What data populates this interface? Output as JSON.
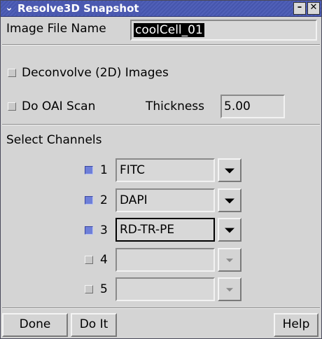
{
  "window": {
    "title": "Resolve3D Snapshot",
    "menu_icon": "chevron-down-icon",
    "minimize_glyph": "–",
    "close_glyph": "✕"
  },
  "image_file": {
    "label": "Image File Name",
    "value": "coolCell_01"
  },
  "options": {
    "deconvolve": {
      "label": "Deconvolve (2D) Images",
      "checked": false
    },
    "oai_scan": {
      "label": "Do OAI Scan",
      "checked": false
    },
    "thickness": {
      "label": "Thickness",
      "value": "5.00"
    }
  },
  "channels": {
    "heading": "Select Channels",
    "items": [
      {
        "number": "1",
        "checked": true,
        "value": "FITC",
        "enabled": true
      },
      {
        "number": "2",
        "checked": true,
        "value": "DAPI",
        "enabled": true
      },
      {
        "number": "3",
        "checked": true,
        "value": "RD-TR-PE",
        "enabled": true
      },
      {
        "number": "4",
        "checked": false,
        "value": "",
        "enabled": false
      },
      {
        "number": "5",
        "checked": false,
        "value": "",
        "enabled": false
      }
    ]
  },
  "buttons": {
    "done": "Done",
    "do_it": "Do It",
    "help": "Help"
  },
  "colors": {
    "titlebar": "#4b59b0",
    "checked": "#6e7fd8",
    "background": "#d4d4d4"
  }
}
